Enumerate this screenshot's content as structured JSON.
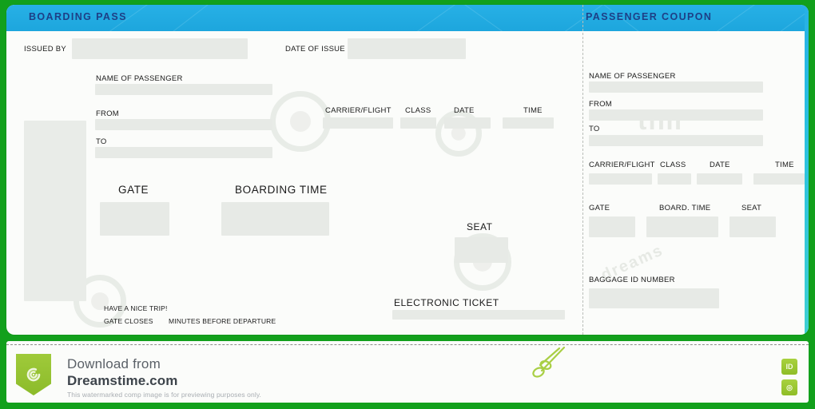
{
  "colors": {
    "outer_border_green": "#12A01C",
    "header_blue": "#22ACE3",
    "header_title_navy": "#1E3F86",
    "field_box_grey": "#E7EAE6",
    "paper_white": "#FBFCFA",
    "watermark_green": "#8FBD27"
  },
  "boarding_pass": {
    "title": "BOARDING PASS",
    "issued_by_label": "ISSUED BY",
    "issued_by_value": "",
    "date_of_issue_label": "DATE OF ISSUE",
    "date_of_issue_value": "",
    "name_of_passenger_label": "NAME OF PASSENGER",
    "name_of_passenger_value": "",
    "from_label": "FROM",
    "from_value": "",
    "to_label": "TO",
    "to_value": "",
    "carrier_flight_label": "CARRIER/FLIGHT",
    "carrier_flight_value": "",
    "class_label": "CLASS",
    "class_value": "",
    "date_label": "DATE",
    "date_value": "",
    "time_label": "TIME",
    "time_value": "",
    "gate_label": "GATE",
    "gate_value": "",
    "boarding_time_label": "BOARDING TIME",
    "boarding_time_value": "",
    "seat_label": "SEAT",
    "seat_value": "",
    "electronic_ticket_label": "ELECTRONIC TICKET",
    "electronic_ticket_value": "",
    "have_a_nice_trip": "HAVE A NICE TRIP!",
    "gate_closes_label": "GATE CLOSES",
    "minutes_before_departure_label": "MINUTES BEFORE DEPARTURE"
  },
  "passenger_coupon": {
    "title": "PASSENGER COUPON",
    "name_of_passenger_label": "NAME OF PASSENGER",
    "name_of_passenger_value": "",
    "from_label": "FROM",
    "from_value": "",
    "to_label": "TO",
    "to_value": "",
    "carrier_flight_label": "CARRIER/FLIGHT",
    "carrier_flight_value": "",
    "class_label": "CLASS",
    "class_value": "",
    "date_label": "DATE",
    "date_value": "",
    "time_label": "TIME",
    "time_value": "",
    "gate_label": "GATE",
    "gate_value": "",
    "board_time_label": "BOARD. TIME",
    "board_time_value": "",
    "seat_label": "SEAT",
    "seat_value": "",
    "baggage_id_label": "BAGGAGE ID NUMBER",
    "baggage_id_value": ""
  },
  "watermark": {
    "line1": "Download from",
    "line2": "Dreamstime.com",
    "line3": "This watermarked comp image is for previewing purposes only.",
    "badge_id": "ID",
    "badge_logo": "◎"
  }
}
